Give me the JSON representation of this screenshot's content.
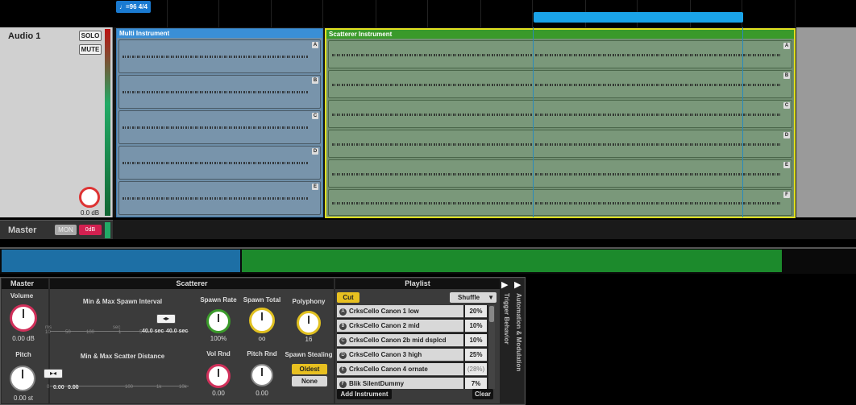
{
  "arrangement": {
    "tempo": "♩=96 4/4",
    "track": {
      "name": "Audio 1",
      "solo_label": "SOLO",
      "mute_label": "MUTE",
      "volume_value": "0.0 dB"
    },
    "regions": {
      "multi": {
        "title": "Multi Instrument",
        "lanes": [
          "A",
          "B",
          "C",
          "D",
          "E"
        ]
      },
      "scatterer": {
        "title": "Scatterer Instrument",
        "lanes": [
          "A",
          "B",
          "C",
          "D",
          "E",
          "F"
        ]
      }
    },
    "master": {
      "name": "Master",
      "mon_label": "MON",
      "volume_label": "0dB"
    }
  },
  "device": {
    "master": {
      "title": "Master",
      "volume_label": "Volume",
      "volume_value": "0.00 dB",
      "pitch_label": "Pitch",
      "pitch_value": "0.00 st"
    },
    "scatterer": {
      "title": "Scatterer",
      "spawn_interval_label": "Min & Max Spawn Interval",
      "spawn_interval_min": "40.0 sec",
      "spawn_interval_max": "40.0 sec",
      "spawn_interval_ticks": [
        "ms",
        "10",
        "50",
        "100",
        "sec",
        "1",
        "5"
      ],
      "scatter_distance_label": "Min & Max Scatter Distance",
      "scatter_distance_min": "0.00",
      "scatter_distance_max": "0.00",
      "scatter_distance_ticks": [
        "0",
        "10",
        "100",
        "1k",
        "10k"
      ],
      "spawn_rate_label": "Spawn Rate",
      "spawn_rate_value": "100%",
      "spawn_total_label": "Spawn Total",
      "spawn_total_value": "oo",
      "polyphony_label": "Polyphony",
      "polyphony_value": "16",
      "vol_rnd_label": "Vol Rnd",
      "vol_rnd_value": "0.00",
      "pitch_rnd_label": "Pitch Rnd",
      "pitch_rnd_value": "0.00",
      "spawn_stealing_label": "Spawn Stealing",
      "oldest_label": "Oldest",
      "none_label": "None"
    },
    "playlist": {
      "title": "Playlist",
      "cut_label": "Cut",
      "mode_label": "Shuffle",
      "items": [
        {
          "letter": "A",
          "name": "CrksCello Canon 1 low",
          "pct": "20%"
        },
        {
          "letter": "B",
          "name": "CrksCello Canon 2 mid",
          "pct": "10%"
        },
        {
          "letter": "C",
          "name": "CrksCello Canon 2b mid dsplcd",
          "pct": "10%"
        },
        {
          "letter": "D",
          "name": "CrksCello Canon 3 high",
          "pct": "25%"
        },
        {
          "letter": "E",
          "name": "CrksCello Canon 4 ornate",
          "pct": "(28%)"
        },
        {
          "letter": "F",
          "name": "Blik SilentDummy",
          "pct": "7%"
        }
      ],
      "add_label": "Add Instrument",
      "clear_label": "Clear"
    },
    "side_tabs": {
      "automation": "Automation & Modulation",
      "trigger": "Trigger Behavior"
    }
  },
  "colors": {
    "multi_region": "#3a8fd6",
    "scatter_region": "#3a9a2a",
    "scatter_border": "#e0e020",
    "loop_bar": "#1aa3e8",
    "active_button": "#e8c020"
  }
}
